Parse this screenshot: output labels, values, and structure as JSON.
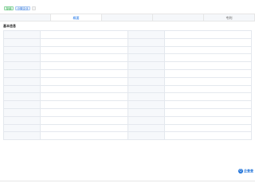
{
  "header": {
    "title": "",
    "tags": [
      {
        "label": "存续",
        "style": "green"
      },
      {
        "label": "小微企业",
        "style": "blue"
      },
      {
        "label": "",
        "style": "gray"
      }
    ]
  },
  "tabs": [
    {
      "label": "",
      "active": false
    },
    {
      "label": "概要",
      "active": true
    },
    {
      "label": "",
      "active": false
    },
    {
      "label": "",
      "active": false
    },
    {
      "label": "专利",
      "active": false
    }
  ],
  "section_title": "基本信息",
  "info_rows": [
    {
      "c1_label": "",
      "c1_value": "",
      "c2_label": "",
      "c2_value": ""
    },
    {
      "c1_label": "",
      "c1_value": "",
      "c2_label": "",
      "c2_value": ""
    },
    {
      "c1_label": "",
      "c1_value": "",
      "c2_label": "",
      "c2_value": ""
    },
    {
      "c1_label": "",
      "c1_value": "",
      "c2_label": "",
      "c2_value": ""
    },
    {
      "c1_label": "",
      "c1_value": "",
      "c2_label": "",
      "c2_value": ""
    },
    {
      "c1_label": "",
      "c1_value": "",
      "c2_label": "",
      "c2_value": ""
    },
    {
      "c1_label": "",
      "c1_value": "",
      "c2_label": "",
      "c2_value": ""
    },
    {
      "c1_label": "",
      "c1_value": "",
      "c2_label": "",
      "c2_value": ""
    },
    {
      "c1_label": "",
      "c1_value": "",
      "c2_label": "",
      "c2_value": ""
    },
    {
      "c1_label": "",
      "c1_value": "",
      "c2_label": "",
      "c2_value": ""
    },
    {
      "c1_label": "",
      "c1_value": "",
      "c2_label": "",
      "c2_value": ""
    },
    {
      "c1_label": "",
      "c1_value": "",
      "c2_label": "",
      "c2_value": ""
    },
    {
      "c1_label": "",
      "c1_value": "",
      "c2_label": "",
      "c2_value": ""
    },
    {
      "c1_label": "",
      "c1_value": "",
      "c2_label": "",
      "c2_value": ""
    }
  ],
  "description": "",
  "bottom_section": "",
  "watermark": "企查查",
  "colors": {
    "accent": "#1a73e8",
    "link": "#3b7ddd",
    "status_green": "#28a745"
  }
}
